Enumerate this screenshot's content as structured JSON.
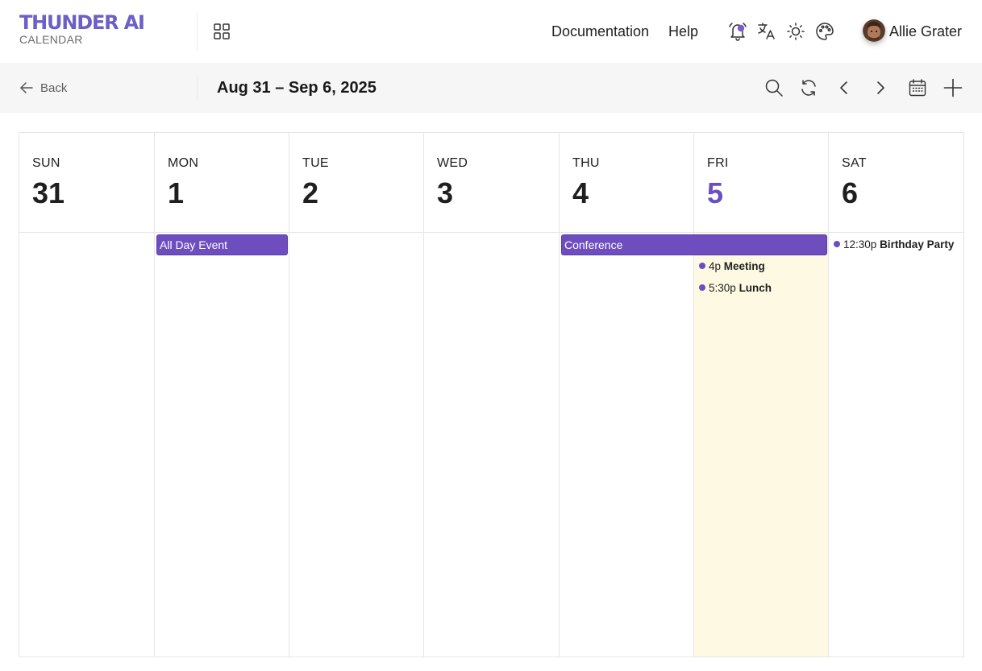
{
  "app": {
    "title": "THUNDER AI",
    "subtitle": "CALENDAR"
  },
  "header": {
    "links": {
      "documentation": "Documentation",
      "help": "Help"
    },
    "user": {
      "name": "Allie Grater"
    }
  },
  "toolbar": {
    "back_label": "Back",
    "range_title": "Aug 31 – Sep 6, 2025"
  },
  "calendar": {
    "days": [
      {
        "dow": "SUN",
        "num": "31"
      },
      {
        "dow": "MON",
        "num": "1"
      },
      {
        "dow": "TUE",
        "num": "2"
      },
      {
        "dow": "WED",
        "num": "3"
      },
      {
        "dow": "THU",
        "num": "4"
      },
      {
        "dow": "FRI",
        "num": "5"
      },
      {
        "dow": "SAT",
        "num": "6"
      }
    ],
    "today_index": 5,
    "allday_events": [
      {
        "title": "All Day Event",
        "start_day": "MON",
        "end_day": "MON"
      },
      {
        "title": "Conference",
        "start_day": "THU",
        "end_day": "FRI"
      }
    ],
    "timed_events": [
      {
        "time": "4p",
        "title": "Meeting",
        "day": "FRI"
      },
      {
        "time": "5:30p",
        "title": "Lunch",
        "day": "FRI"
      },
      {
        "time": "12:30p",
        "title": "Birthday Party",
        "day": "SAT"
      }
    ]
  },
  "colors": {
    "accent": "#6a4fc0",
    "event_bg": "#6e4dbf",
    "today_bg": "#fef9e2",
    "toolbar_bg": "#f6f6f6"
  },
  "icons": [
    "apps-grid-icon",
    "bell-icon",
    "translate-icon",
    "sun-icon",
    "palette-icon",
    "arrow-left-icon",
    "search-icon",
    "refresh-icon",
    "chevron-left-icon",
    "chevron-right-icon",
    "calendar-icon",
    "plus-icon"
  ]
}
